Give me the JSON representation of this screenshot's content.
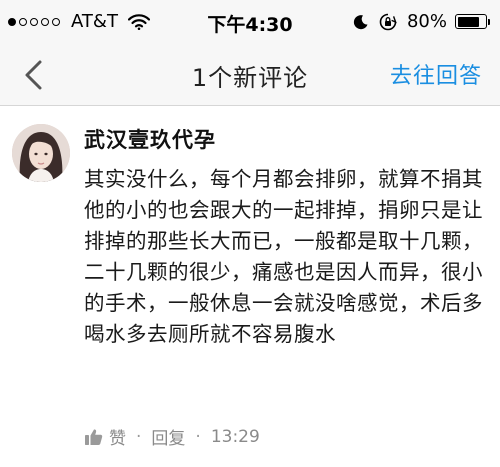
{
  "status_bar": {
    "carrier": "AT&T",
    "time": "下午4:30",
    "battery": "80%",
    "battery_level": 0.8
  },
  "nav": {
    "title": "1个新评论",
    "action": "去往回答"
  },
  "comment": {
    "author": "武汉壹玖代孕",
    "body": "其实没什么，每个月都会排卵，就算不捐其他的小的也会跟大的一起排掉，捐卵只是让排掉的那些长大而已，一般都是取十几颗，二十几颗的很少，痛感也是因人而异，很小的手术，一般休息一会就没啥感觉，术后多喝水多去厕所就不容易腹水",
    "like_label": "赞",
    "reply_label": "回复",
    "time": "13:29"
  },
  "colors": {
    "accent": "#1a8ee1",
    "bar_background": "#f7f7f7",
    "meta_text": "#8a8a8a"
  },
  "icons": {
    "back": "chevron-left-icon",
    "wifi": "wifi-icon",
    "moon": "moon-icon",
    "lock": "orientation-lock-icon",
    "like": "thumbs-up-icon"
  }
}
